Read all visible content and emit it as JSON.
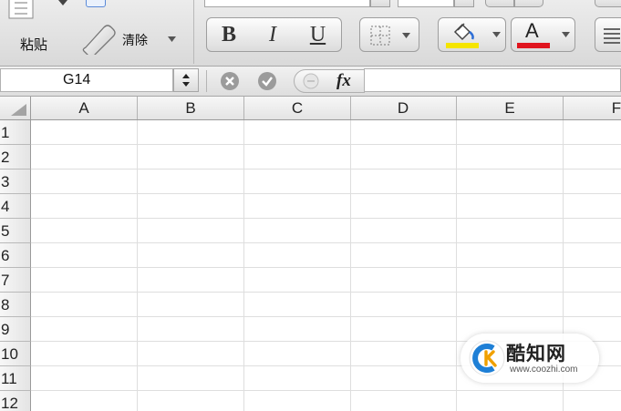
{
  "ribbon": {
    "paste_label": "粘贴",
    "clear_label": "清除",
    "bold": "B",
    "italic": "I",
    "underline": "U",
    "font_color_letter": "A",
    "colors": {
      "highlight": "#f5e500",
      "font": "#e0141e"
    }
  },
  "formula_bar": {
    "cell_reference": "G14",
    "fx_label": "fx",
    "formula_value": ""
  },
  "sheet": {
    "columns": [
      "A",
      "B",
      "C",
      "D",
      "E",
      "F"
    ],
    "rows": [
      "1",
      "2",
      "3",
      "4",
      "5",
      "6",
      "7",
      "8",
      "9",
      "10",
      "11",
      "12"
    ]
  },
  "watermark": {
    "title": "酷知网",
    "url": "www.coozhi.com"
  }
}
